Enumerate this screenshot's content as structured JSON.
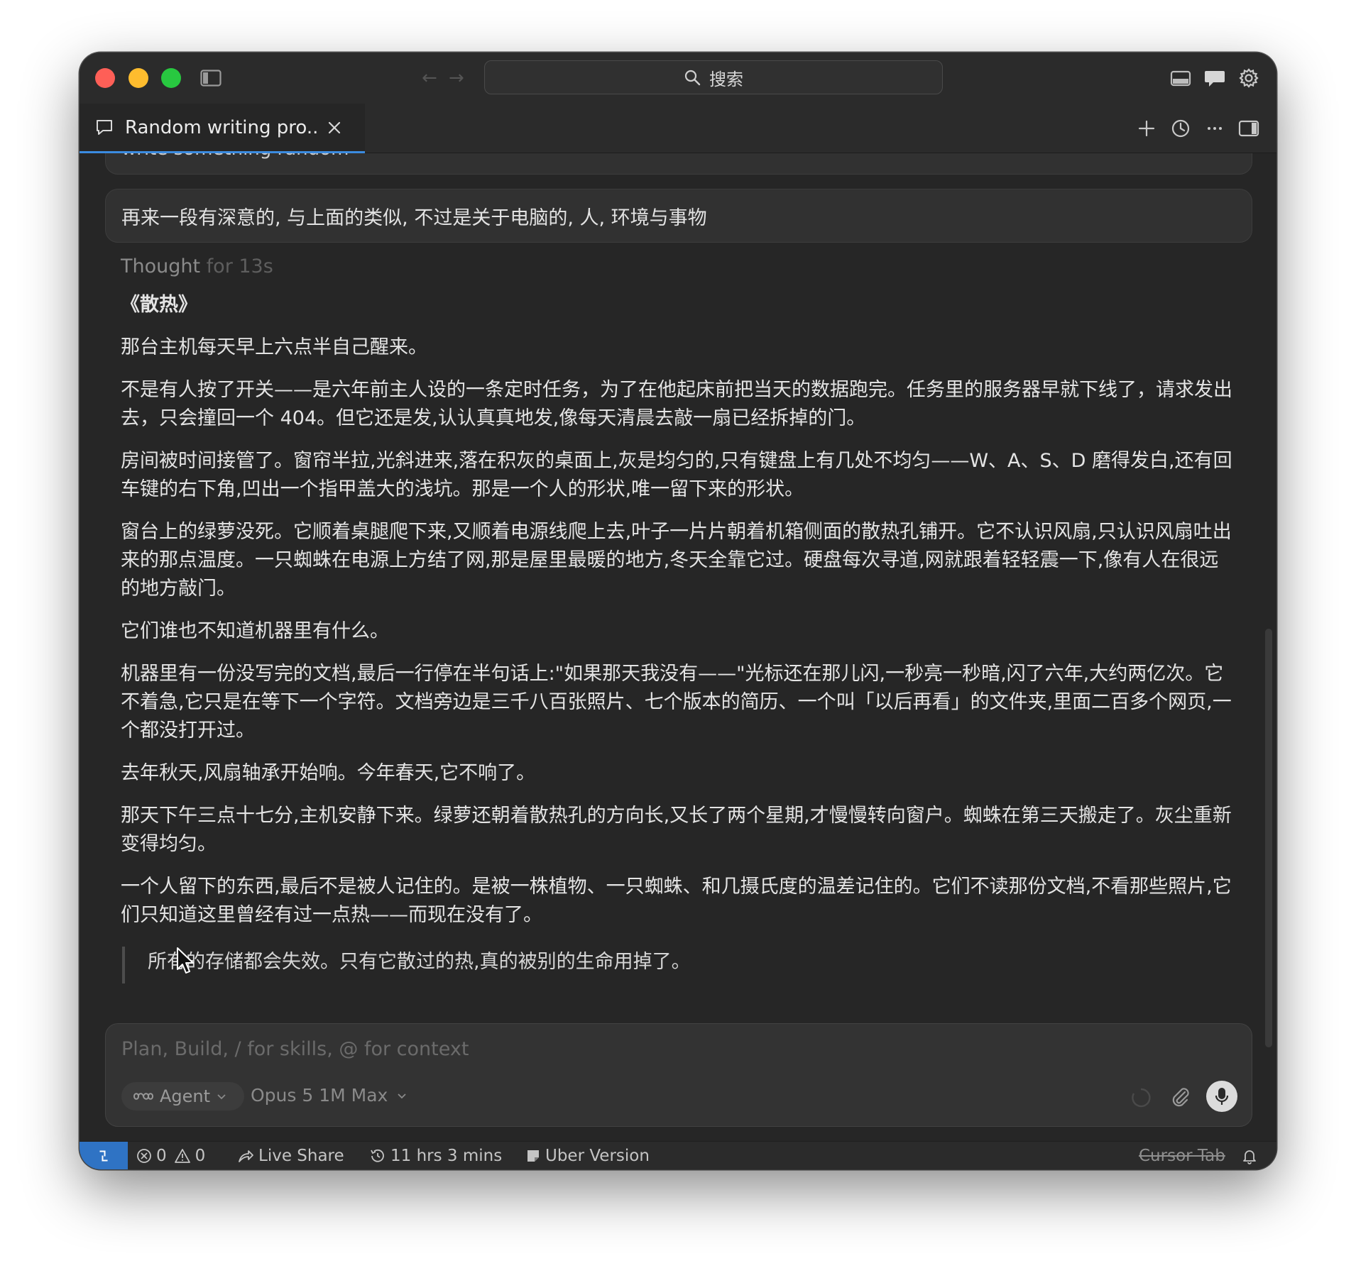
{
  "search": {
    "label": "搜索"
  },
  "tab": {
    "title": "Random writing pro..."
  },
  "chat": {
    "previous_message": "write something random",
    "user_message": "再来一段有深意的, 与上面的类似, 不过是关于电脑的, 人, 环境与事物",
    "thought_label": "Thought",
    "thought_duration": "for 13s",
    "title": "《散热》",
    "paragraphs": [
      "那台主机每天早上六点半自己醒来。",
      "不是有人按了开关——是六年前主人设的一条定时任务，为了在他起床前把当天的数据跑完。任务里的服务器早就下线了，请求发出去，只会撞回一个 404。但它还是发,认认真真地发,像每天清晨去敲一扇已经拆掉的门。",
      "房间被时间接管了。窗帘半拉,光斜进来,落在积灰的桌面上,灰是均匀的,只有键盘上有几处不均匀——W、A、S、D 磨得发白,还有回车键的右下角,凹出一个指甲盖大的浅坑。那是一个人的形状,唯一留下来的形状。",
      "窗台上的绿萝没死。它顺着桌腿爬下来,又顺着电源线爬上去,叶子一片片朝着机箱侧面的散热孔铺开。它不认识风扇,只认识风扇吐出来的那点温度。一只蜘蛛在电源上方结了网,那是屋里最暖的地方,冬天全靠它过。硬盘每次寻道,网就跟着轻轻震一下,像有人在很远的地方敲门。",
      "它们谁也不知道机器里有什么。",
      "机器里有一份没写完的文档,最后一行停在半句话上:\"如果那天我没有——\"光标还在那儿闪,一秒亮一秒暗,闪了六年,大约两亿次。它不着急,它只是在等下一个字符。文档旁边是三千八百张照片、七个版本的简历、一个叫「以后再看」的文件夹,里面二百多个网页,一个都没打开过。",
      "去年秋天,风扇轴承开始响。今年春天,它不响了。",
      "那天下午三点十七分,主机安静下来。绿萝还朝着散热孔的方向长,又长了两个星期,才慢慢转向窗户。蜘蛛在第三天搬走了。灰尘重新变得均匀。",
      "一个人留下的东西,最后不是被人记住的。是被一株植物、一只蜘蛛、和几摄氏度的温差记住的。它们不读那份文档,不看那些照片,它们只知道这里曾经有过一点热——而现在没有了。"
    ],
    "quote": "所有的存储都会失效。只有它散过的热,真的被别的生命用掉了。"
  },
  "composer": {
    "placeholder": "Plan, Build, / for skills, @ for context",
    "mode": "Agent",
    "model": "Opus 5 1M Max"
  },
  "status": {
    "errors": "0",
    "warnings": "0",
    "live_share": "Live Share",
    "time": "11 hrs 3 mins",
    "version": "Uber Version",
    "cursor_tab": "Cursor Tab"
  },
  "colors": {
    "accent": "#3b8be0",
    "remote": "#2f73c4",
    "close": "#fe5f57",
    "minimize": "#febc2e",
    "maximize": "#28c840"
  }
}
